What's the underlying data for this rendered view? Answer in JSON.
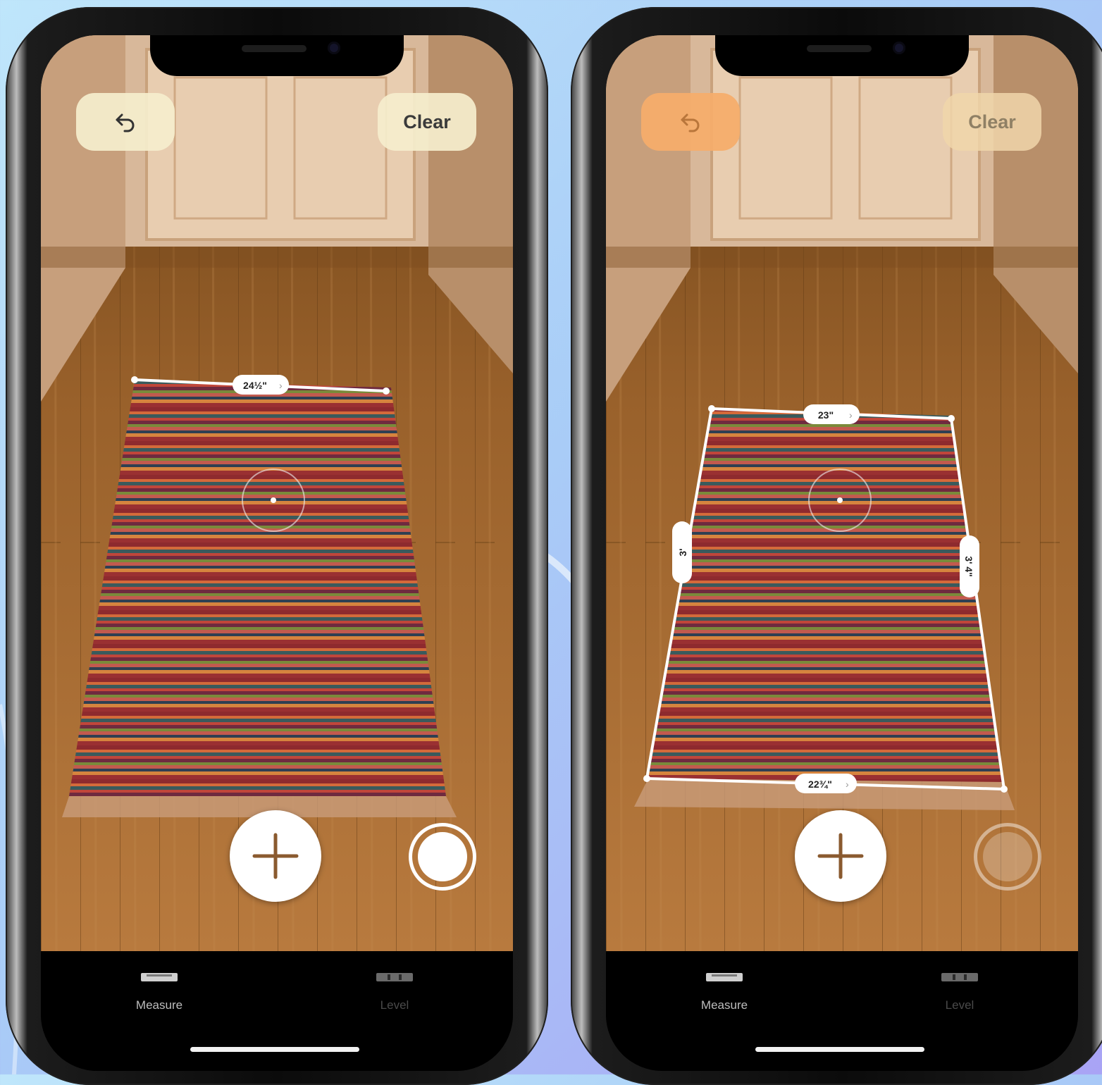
{
  "screens": [
    {
      "undo_icon": "undo-arrow-icon",
      "clear_label": "Clear",
      "measurements": {
        "top": "24½\""
      },
      "add_icon": "plus-icon",
      "tabs": [
        {
          "label": "Measure",
          "icon": "ruler-icon",
          "selected": true
        },
        {
          "label": "Level",
          "icon": "level-icon",
          "selected": false
        }
      ]
    },
    {
      "undo_icon": "undo-arrow-icon",
      "clear_label": "Clear",
      "measurements": {
        "top": "23\"",
        "left": "3'",
        "right": "3' 4\"",
        "bottom": "22¾\""
      },
      "add_icon": "plus-icon",
      "tabs": [
        {
          "label": "Measure",
          "icon": "ruler-icon",
          "selected": true
        },
        {
          "label": "Level",
          "icon": "level-icon",
          "selected": false
        }
      ]
    }
  ],
  "colors": {
    "accent_button_active": "#f5eecd",
    "accent_button_undo_faded": "#f6ad6c",
    "measurement_line": "#ffffff",
    "floor": "#a86a32"
  }
}
